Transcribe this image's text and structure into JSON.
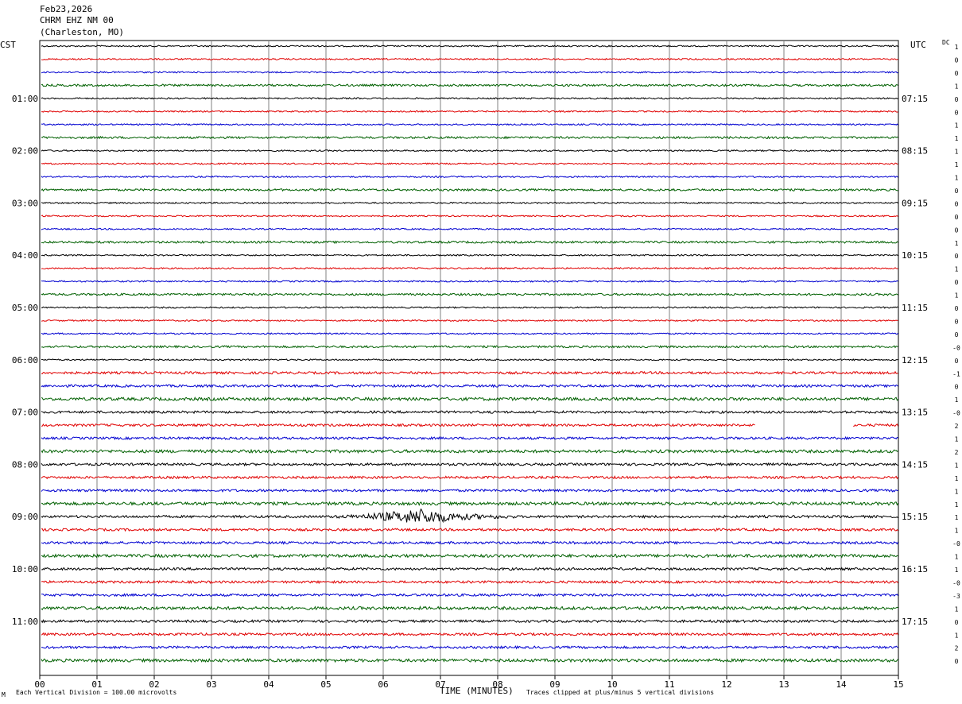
{
  "header": {
    "date": "Feb23,2026",
    "station": "CHRM EHZ NM 00",
    "location": "(Charleston, MO)"
  },
  "left_axis_title": "CST",
  "right_axis_title": "UTC",
  "dc_title": "DC",
  "footer": {
    "xlabel": "TIME (MINUTES)",
    "scale_note": "Each Vertical Division =  100.00 microvolts",
    "clip_note": "Traces clipped at plus/minus 5 vertical divisions",
    "corner_mark": "M"
  },
  "colors": {
    "series": [
      "#000000",
      "#e00000",
      "#0000d0",
      "#006000"
    ],
    "grid": "#808080"
  },
  "chart_data": {
    "type": "line",
    "title": "",
    "xlabel": "TIME (MINUTES)",
    "ylabel": "",
    "xlim": [
      0,
      15
    ],
    "x_ticks": [
      "00",
      "01",
      "02",
      "03",
      "04",
      "05",
      "06",
      "07",
      "08",
      "09",
      "10",
      "11",
      "12",
      "13",
      "14",
      "15"
    ],
    "grid": true,
    "trace_count": 48,
    "left_labels": [
      "01:00",
      "02:00",
      "03:00",
      "04:00",
      "05:00",
      "06:00",
      "07:00",
      "08:00",
      "09:00",
      "10:00",
      "11:00"
    ],
    "right_labels": [
      "07:15",
      "08:15",
      "09:15",
      "10:15",
      "11:15",
      "12:15",
      "13:15",
      "14:15",
      "15:15",
      "16:15",
      "17:15"
    ],
    "dc_values": [
      "1",
      "0",
      "0",
      "1",
      "0",
      "0",
      "1",
      "1",
      "1",
      "1",
      "1",
      "0",
      "0",
      "0",
      "0",
      "1",
      "0",
      "1",
      "0",
      "1",
      "0",
      "0",
      "0",
      "-0",
      "0",
      "-1",
      "0",
      "1",
      "-0",
      "2",
      "1",
      "2",
      "1",
      "1",
      "1",
      "1",
      "1",
      "1",
      "-0",
      "1",
      "1",
      "-0",
      "-3",
      "1",
      "0",
      "1",
      "2",
      "0"
    ],
    "events": [
      {
        "trace": 36,
        "start_min": 4.8,
        "end_min": 8.3,
        "peak_min": 6.7,
        "description": ""
      }
    ],
    "gaps": [
      {
        "trace": 29,
        "start_min": 12.5,
        "end_min": 14.2
      }
    ]
  }
}
